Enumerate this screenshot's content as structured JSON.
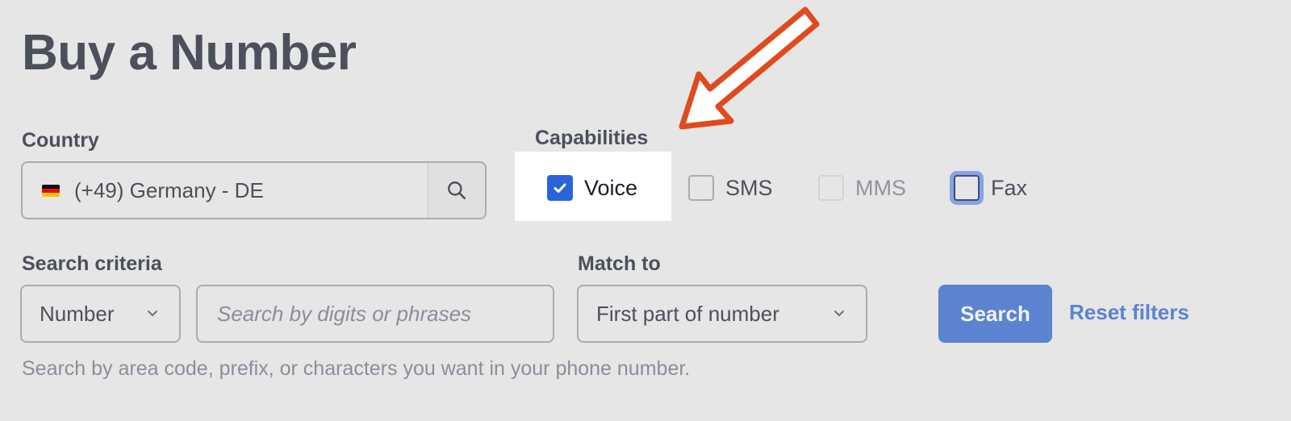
{
  "page": {
    "title": "Buy a Number"
  },
  "country": {
    "label": "Country",
    "flag_icon": "germany-flag-icon",
    "value": "(+49) Germany - DE",
    "search_icon": "search-icon"
  },
  "capabilities": {
    "label": "Capabilities",
    "items": [
      {
        "label": "Voice",
        "checked": true,
        "disabled": false,
        "focused": false,
        "highlighted": true
      },
      {
        "label": "SMS",
        "checked": false,
        "disabled": false,
        "focused": false
      },
      {
        "label": "MMS",
        "checked": false,
        "disabled": true,
        "focused": false
      },
      {
        "label": "Fax",
        "checked": false,
        "disabled": false,
        "focused": true
      }
    ]
  },
  "search_criteria": {
    "label": "Search criteria",
    "type_value": "Number",
    "input_placeholder": "Search by digits or phrases",
    "input_value": "",
    "help_text": "Search by area code, prefix, or characters you want in your phone number."
  },
  "match_to": {
    "label": "Match to",
    "value": "First part of number"
  },
  "actions": {
    "search_label": "Search",
    "reset_label": "Reset filters"
  },
  "annotation": {
    "arrow_color": "#e04a1f",
    "points_to": "Voice"
  },
  "colors": {
    "accent": "#5b83cf",
    "checkbox_checked": "#2b63d9",
    "background": "#e6e6e6"
  }
}
